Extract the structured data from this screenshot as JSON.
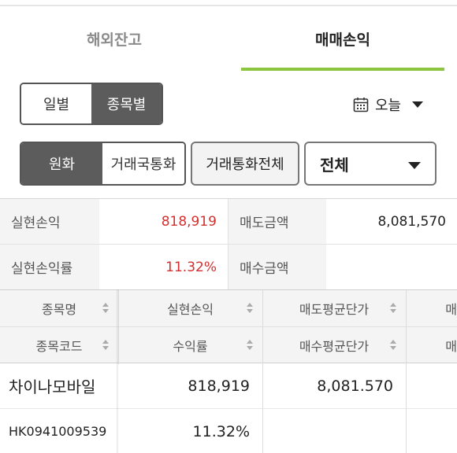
{
  "tabs": [
    {
      "label": "해외잔고",
      "active": false
    },
    {
      "label": "매매손익",
      "active": true
    }
  ],
  "period_toggle": {
    "options": [
      "일별",
      "종목별"
    ],
    "selected": "종목별"
  },
  "date_selector": {
    "label": "오늘",
    "icon": "calendar-icon"
  },
  "currency_toggle": {
    "options": [
      "원화",
      "거래국통화"
    ],
    "selected": "원화"
  },
  "all_currency_button": "거래통화전체",
  "filter_select": {
    "value": "전체"
  },
  "summary": {
    "realized_pnl_label": "실현손익",
    "realized_pnl_value": "818,919",
    "sell_amount_label": "매도금액",
    "sell_amount_value": "8,081,570",
    "realized_rate_label": "실현손익률",
    "realized_rate_value": "11.32%",
    "buy_amount_label": "매수금액",
    "buy_amount_value": ""
  },
  "grid": {
    "headers_row1": [
      "종목명",
      "실현손익",
      "매도평균단가",
      "매"
    ],
    "headers_row2": [
      "종목코드",
      "수익률",
      "매수평균단가",
      "매"
    ],
    "rows": [
      {
        "name": "차이나모바일",
        "realized_pnl": "818,919",
        "sell_avg_price": "8,081.570",
        "code": "HK0941009539",
        "rate": "11.32%",
        "buy_avg_price": ""
      }
    ]
  },
  "colors": {
    "accent": "#8cc63f",
    "positive": "#d32f2f",
    "toggle_active": "#5c5c5c"
  }
}
